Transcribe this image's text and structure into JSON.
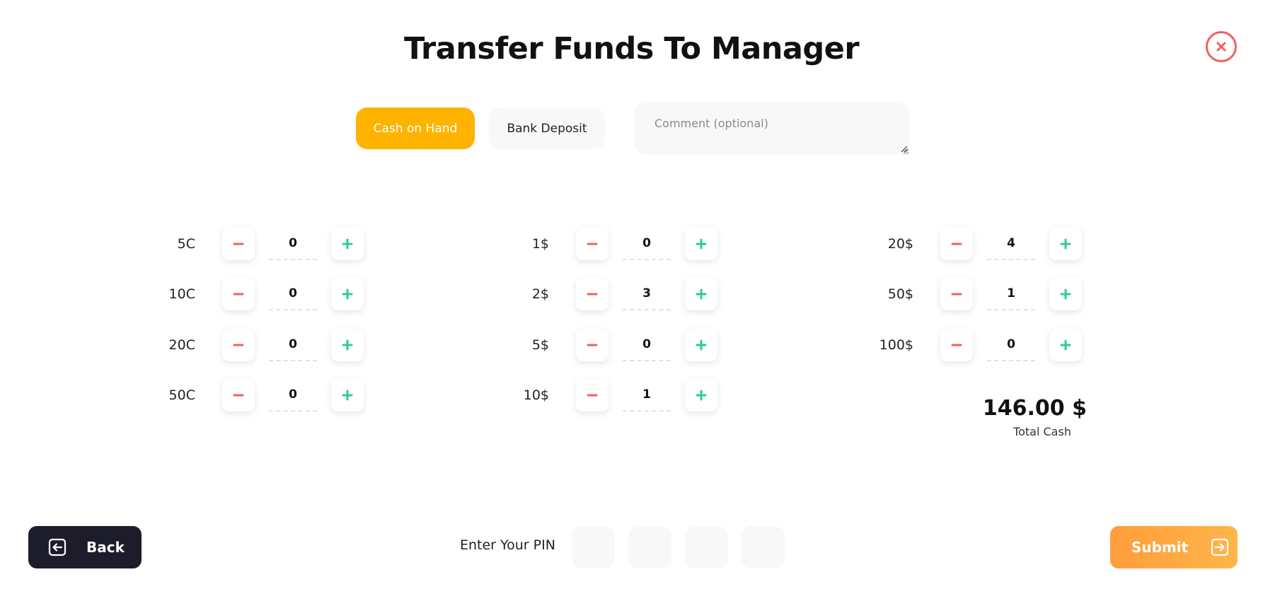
{
  "title": "Transfer Funds To Manager",
  "tabs": {
    "active": "Cash on Hand",
    "inactive": "Bank Deposit"
  },
  "comment": {
    "placeholder": "Comment (optional)",
    "value": ""
  },
  "denominations": {
    "col1": [
      {
        "label": "5C",
        "qty": "0"
      },
      {
        "label": "10C",
        "qty": "0"
      },
      {
        "label": "20C",
        "qty": "0"
      },
      {
        "label": "50C",
        "qty": "0"
      }
    ],
    "col2": [
      {
        "label": "1$",
        "qty": "0"
      },
      {
        "label": "2$",
        "qty": "3"
      },
      {
        "label": "5$",
        "qty": "0"
      },
      {
        "label": "10$",
        "qty": "1"
      }
    ],
    "col3": [
      {
        "label": "20$",
        "qty": "4"
      },
      {
        "label": "50$",
        "qty": "1"
      },
      {
        "label": "100$",
        "qty": "0"
      }
    ]
  },
  "total": {
    "amount": "146.00 $",
    "label": "Total Cash"
  },
  "footer": {
    "back_label": "Back",
    "pin_label": "Enter Your PIN",
    "submit_label": "Submit"
  },
  "icons": {
    "close": "close-icon",
    "minus": "minus-icon",
    "plus": "plus-icon",
    "back": "arrow-left-box-icon",
    "submit": "arrow-right-box-icon"
  },
  "colors": {
    "accent": "#fdb300",
    "minus": "#f06060",
    "plus": "#2ecc8f",
    "dark_button": "#1c1c2b",
    "submit_gradient_start": "#ff9d3c",
    "submit_gradient_end": "#ffb54a"
  }
}
